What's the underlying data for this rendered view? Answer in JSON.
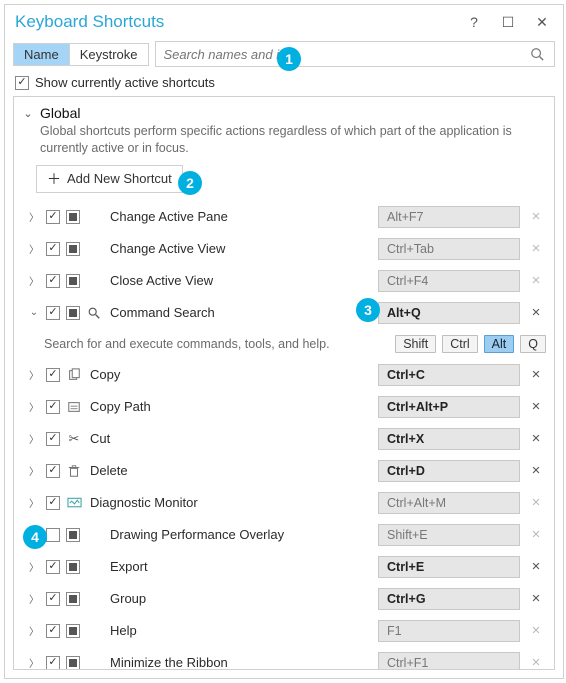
{
  "window": {
    "title": "Keyboard Shortcuts"
  },
  "tabs": {
    "name": "Name",
    "keystroke": "Keystroke"
  },
  "search": {
    "placeholder": "Search names and ids"
  },
  "show_active_label": "Show currently active shortcuts",
  "group": {
    "name": "Global",
    "desc": "Global shortcuts perform specific actions regardless of which part of the application is currently active or in focus.",
    "add_label": "Add New Shortcut"
  },
  "detail": {
    "text": "Search for and execute commands, tools, and help.",
    "k1": "Shift",
    "k2": "Ctrl",
    "k3": "Alt",
    "k4": "Q"
  },
  "rows": {
    "r0": {
      "label": "Change Active Pane",
      "shortcut": "Alt+F7"
    },
    "r1": {
      "label": "Change Active View",
      "shortcut": "Ctrl+Tab"
    },
    "r2": {
      "label": "Close Active View",
      "shortcut": "Ctrl+F4"
    },
    "r3": {
      "label": "Command Search",
      "shortcut": "Alt+Q"
    },
    "r4": {
      "label": "Copy",
      "shortcut": "Ctrl+C"
    },
    "r5": {
      "label": "Copy Path",
      "shortcut": "Ctrl+Alt+P"
    },
    "r6": {
      "label": "Cut",
      "shortcut": "Ctrl+X"
    },
    "r7": {
      "label": "Delete",
      "shortcut": "Ctrl+D"
    },
    "r8": {
      "label": "Diagnostic Monitor",
      "shortcut": "Ctrl+Alt+M"
    },
    "r9": {
      "label": "Drawing Performance Overlay",
      "shortcut": "Shift+E"
    },
    "r10": {
      "label": "Export",
      "shortcut": "Ctrl+E"
    },
    "r11": {
      "label": "Group",
      "shortcut": "Ctrl+G"
    },
    "r12": {
      "label": "Help",
      "shortcut": "F1"
    },
    "r13": {
      "label": "Minimize the Ribbon",
      "shortcut": "Ctrl+F1"
    }
  },
  "callouts": {
    "b1": "1",
    "b2": "2",
    "b3": "3",
    "b4": "4"
  }
}
